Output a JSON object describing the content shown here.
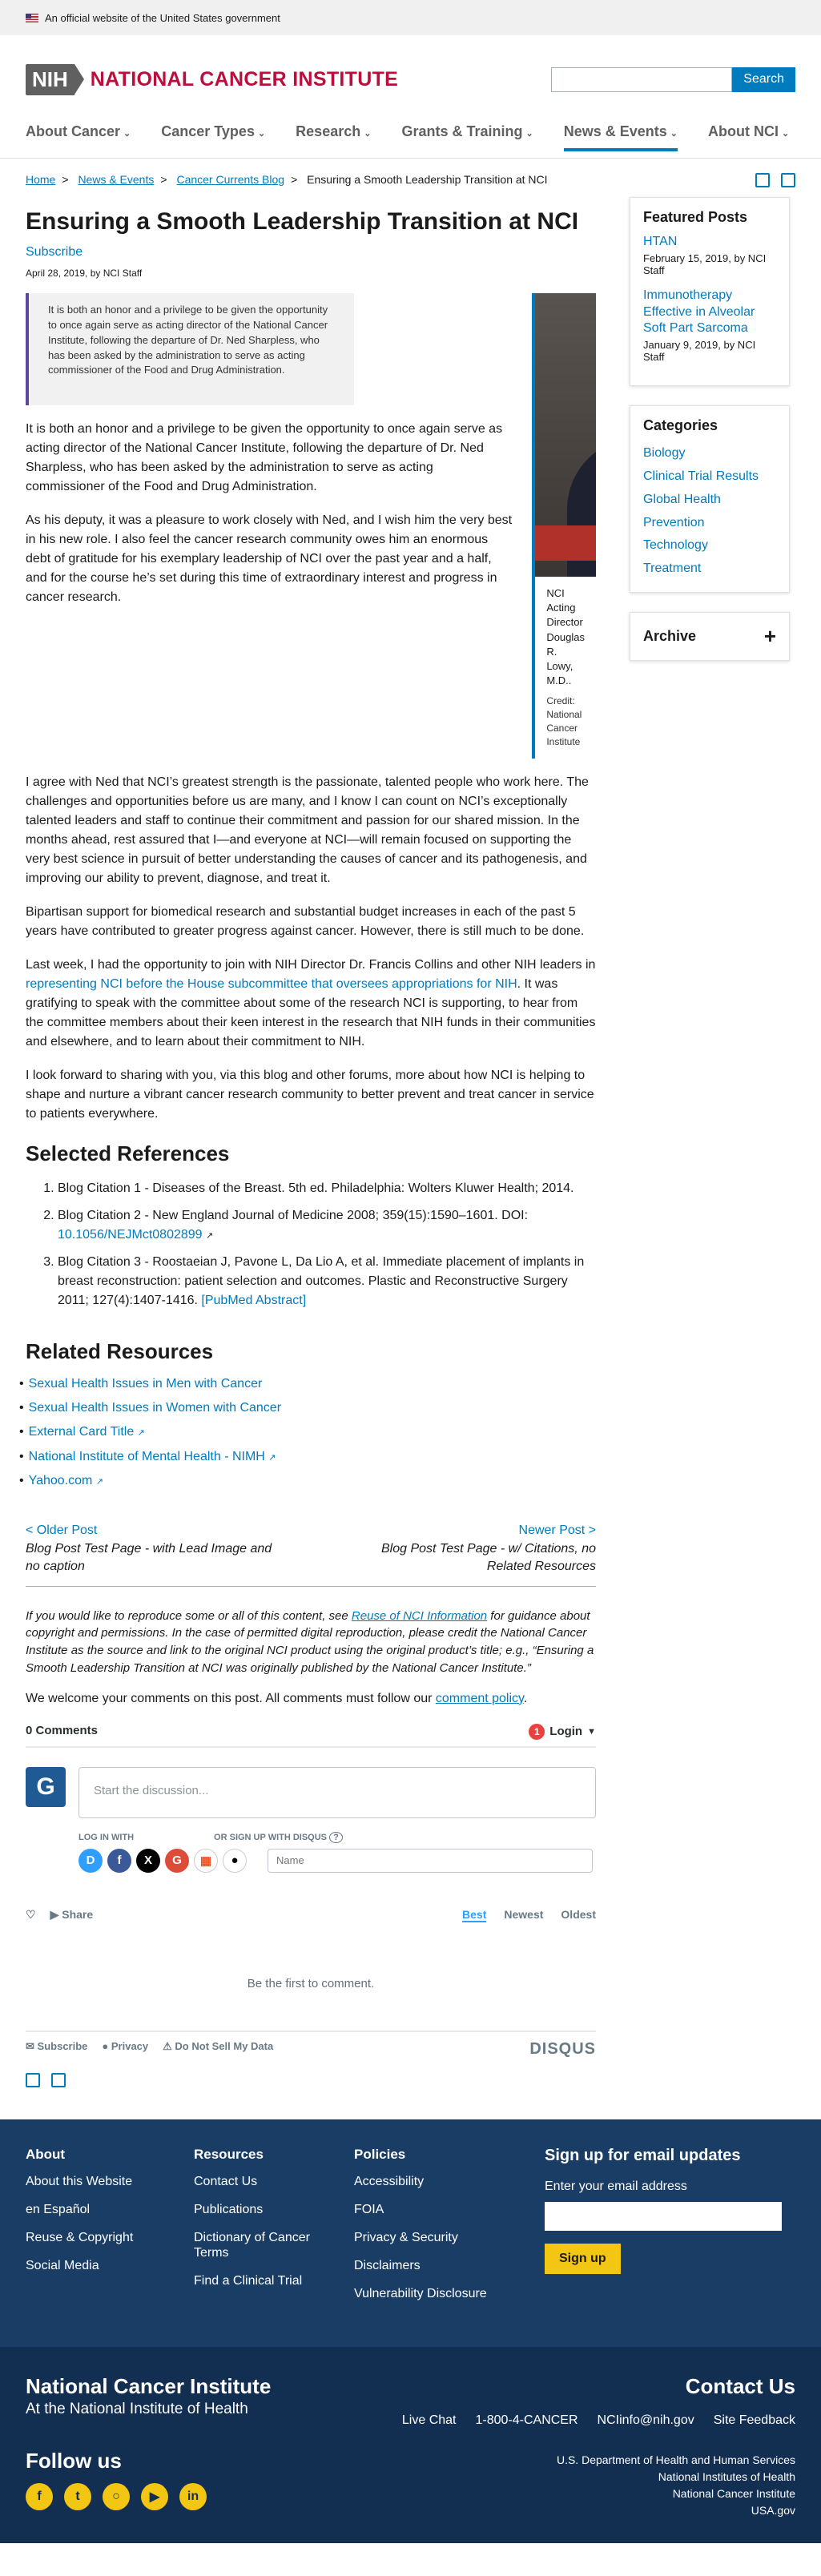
{
  "gov_banner": "An official website of the United States government",
  "header": {
    "logo_abbr": "NIH",
    "logo_name": "NATIONAL CANCER INSTITUTE",
    "search_button": "Search",
    "search_placeholder": ""
  },
  "nav": [
    "About Cancer",
    "Cancer Types",
    "Research",
    "Grants & Training",
    "News & Events",
    "About NCI"
  ],
  "breadcrumbs": [
    "Home",
    "News & Events",
    "Cancer Currents Blog",
    "Ensuring a Smooth Leadership Transition at NCI"
  ],
  "article": {
    "title": "Ensuring a Smooth Leadership Transition at NCI",
    "subscribe": "Subscribe",
    "date": "April 28, 2019, by NCI Staff",
    "pullquote": "It is both an honor and a privilege to be given the opportunity to once again serve as acting director of the National Cancer Institute, following the departure of Dr. Ned Sharpless, who has been asked by the administration to serve as acting commissioner of the Food and Drug Administration.",
    "image_caption": "NCI Acting Director Douglas R. Lowy, M.D..",
    "image_credit": "Credit: National Cancer Institute",
    "p1": "It is both an honor and a privilege to be given the opportunity to once again serve as acting director of the National Cancer Institute, following the departure of Dr. Ned Sharpless, who has been asked by the administration to serve as acting commissioner of the Food and Drug Administration.",
    "p2": "As his deputy, it was a pleasure to work closely with Ned, and I wish him the very best in his new role. I also feel the cancer research community owes him an enormous debt of gratitude for his exemplary leadership of NCI over the past year and a half, and for the course he’s set during this time of extraordinary interest and progress in cancer research.",
    "p3": "I agree with Ned that NCI’s greatest strength is the passionate, talented people who work here. The challenges and opportunities before us are many, and I know I can count on NCI’s exceptionally talented leaders and staff to continue their commitment and passion for our shared mission. In the months ahead, rest assured that I—and everyone at NCI—will remain focused on supporting the very best science in pursuit of better understanding the causes of cancer and its pathogenesis, and improving our ability to prevent, diagnose, and treat it.",
    "p4": "Bipartisan support for biomedical research and substantial budget increases in each of the past 5 years have contributed to greater progress against cancer. However, there is still much to be done.",
    "p5_before": "Last week, I had the opportunity to join with NIH Director Dr. Francis Collins and other NIH leaders in ",
    "p5_link": "representing NCI before the House subcommittee that oversees appropriations for NIH",
    "p5_after": ". It was gratifying to speak with the committee about some of the research NCI is supporting, to hear from the committee members about their keen interest in the research that NIH funds in their communities and elsewhere, and to learn about their commitment to NIH.",
    "p6": "I look forward to sharing with you, via this blog and other forums, more about how NCI is helping to shape and nurture a vibrant cancer research community to better prevent and treat cancer in service to patients everywhere."
  },
  "references": {
    "heading": "Selected References",
    "r1": "Blog Citation 1 - Diseases of the Breast. 5th ed. Philadelphia: Wolters Kluwer Health; 2014.",
    "r2": "Blog Citation 2 - New England Journal of Medicine 2008; 359(15):1590–1601. DOI:",
    "r2_link": "10.1056/NEJMct0802899",
    "r3": "Blog Citation 3 - Roostaeian J, Pavone L, Da Lio A, et al. Immediate placement of implants in breast reconstruction: patient selection and outcomes. Plastic and Reconstructive Surgery 2011; 127(4):1407-1416.",
    "r3_link": "[PubMed Abstract]"
  },
  "related": {
    "heading": "Related Resources",
    "items": [
      "Sexual Health Issues in Men with Cancer",
      "Sexual Health Issues in Women with Cancer",
      "External Card Title",
      "National Institute of Mental Health - NIMH",
      "Yahoo.com"
    ]
  },
  "pager": {
    "older_label": "< Older Post",
    "older_title": "Blog Post Test Page - with Lead Image and no caption",
    "newer_label": "Newer Post >",
    "newer_title": "Blog Post Test Page - w/ Citations, no Related Resources"
  },
  "repro": {
    "before": "If you would like to reproduce some or all of this content, see ",
    "link": "Reuse of NCI Information",
    "after": " for guidance about copyright and permissions. In the case of permitted digital reproduction, please credit the National Cancer Institute as the source and link to the original NCI product using the original product’s title; e.g., “Ensuring a Smooth Leadership Transition at NCI was originally published by the National Cancer Institute.”"
  },
  "comments_note": {
    "before": "We welcome your comments on this post. All comments must follow our ",
    "link": "comment policy",
    "after": "."
  },
  "disqus": {
    "count": "0 Comments",
    "badge": "1",
    "login": "Login",
    "avatar_letter": "G",
    "compose_placeholder": "Start the discussion...",
    "login_with": "LOG IN WITH",
    "signup_with": "OR SIGN UP WITH DISQUS",
    "help": "?",
    "name_placeholder": "Name",
    "share": "Share",
    "sort_best": "Best",
    "sort_newest": "Newest",
    "sort_oldest": "Oldest",
    "empty": "Be the first to comment.",
    "footer_subscribe": "Subscribe",
    "footer_privacy": "Privacy",
    "footer_dnsmd": "Do Not Sell My Data",
    "brand": "DISQUS"
  },
  "sidebar": {
    "featured_heading": "Featured Posts",
    "featured": [
      {
        "title": "HTAN",
        "meta": "February 15, 2019, by NCI Staff"
      },
      {
        "title": "Immunotherapy Effective in Alveolar Soft Part Sarcoma",
        "meta": "January 9, 2019, by NCI Staff"
      }
    ],
    "categories_heading": "Categories",
    "categories": [
      "Biology",
      "Clinical Trial Results",
      "Global Health",
      "Prevention",
      "Technology",
      "Treatment"
    ],
    "archive": "Archive",
    "archive_toggle": "+"
  },
  "footer": {
    "about_heading": "About",
    "about": [
      "About this Website",
      "en Español",
      "Reuse & Copyright",
      "Social Media"
    ],
    "resources_heading": "Resources",
    "resources": [
      "Contact Us",
      "Publications",
      "Dictionary of Cancer Terms",
      "Find a Clinical Trial"
    ],
    "policies_heading": "Policies",
    "policies": [
      "Accessibility",
      "FOIA",
      "Privacy & Security",
      "Disclaimers",
      "Vulnerability Disclosure"
    ],
    "signup_heading": "Sign up for email updates",
    "signup_label": "Enter your email address",
    "signup_button": "Sign up",
    "nci_name": "National Cancer Institute",
    "nci_sub": "At the National Institute of Health",
    "contact_heading": "Contact Us",
    "contact_links": [
      "Live Chat",
      "1-800-4-CANCER",
      "NCIinfo@nih.gov",
      "Site Feedback"
    ],
    "follow_heading": "Follow us",
    "gov_links": [
      "U.S. Department of Health and Human Services",
      "National Institutes of Health",
      "National Cancer Institute",
      "USA.gov"
    ]
  }
}
